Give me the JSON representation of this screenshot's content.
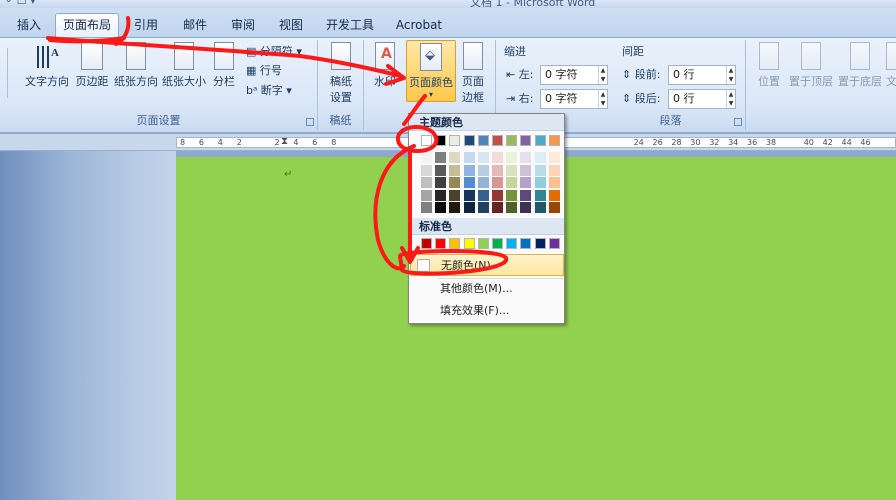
{
  "window": {
    "title": "文档 1 - Microsoft Word",
    "qat": "⚬ ☐ ▾"
  },
  "tabs": [
    "插入",
    "页面布局",
    "引用",
    "邮件",
    "审阅",
    "视图",
    "开发工具",
    "Acrobat"
  ],
  "ribbon": {
    "page_setup": {
      "label": "页面设置",
      "text_direction": "文字方向",
      "margins": "页边距",
      "orientation": "纸张方向",
      "size": "纸张大小",
      "columns": "分栏",
      "breaks": "分隔符",
      "line_numbers": "行号",
      "hyphenation": "断字"
    },
    "draft": {
      "label": "稿纸",
      "button_line1": "稿纸",
      "button_line2": "设置"
    },
    "background": {
      "watermark": "水印",
      "page_color": "页面颜色",
      "page_borders_line1": "页面",
      "page_borders_line2": "边框"
    },
    "paragraph": {
      "label": "段落",
      "indent_title": "缩进",
      "spacing_title": "间距",
      "indent_left_label": "左:",
      "indent_left_value": "0 字符",
      "indent_right_label": "右:",
      "indent_right_value": "0 字符",
      "spacing_before_label": "段前:",
      "spacing_before_value": "0 行",
      "spacing_after_label": "段后:",
      "spacing_after_value": "0 行"
    },
    "arrange": {
      "position": "位置",
      "bring_front": "置于顶层",
      "send_back": "置于底层",
      "text_wrap": "文"
    }
  },
  "ruler": {
    "numbers": [
      "8",
      "6",
      "4",
      "2",
      "",
      "2",
      "4",
      "6",
      "8",
      "",
      "",
      "",
      "",
      "",
      "",
      "",
      "",
      "",
      "",
      "",
      "",
      "",
      "",
      "",
      "24",
      "26",
      "28",
      "30",
      "32",
      "34",
      "36",
      "38",
      "",
      "40",
      "42",
      "44",
      "46"
    ]
  },
  "color_menu": {
    "theme_title": "主题颜色",
    "standard_title": "标准色",
    "theme_colors": [
      "#ffffff",
      "#000000",
      "#eeece1",
      "#1f497d",
      "#4f81bd",
      "#c0504d",
      "#9bbb59",
      "#8064a2",
      "#4bacc6",
      "#f79646"
    ],
    "shade_rows": [
      [
        "#f2f2f2",
        "#7f7f7f",
        "#ddd9c3",
        "#c6d9f0",
        "#dbe5f1",
        "#f2dcdb",
        "#ebf1dd",
        "#e5e0ec",
        "#dbeef3",
        "#fdeada"
      ],
      [
        "#d8d8d8",
        "#595959",
        "#c4bd97",
        "#8db3e2",
        "#b8cce4",
        "#e5b9b7",
        "#d7e3bc",
        "#ccc1d9",
        "#b7dde8",
        "#fbd5b5"
      ],
      [
        "#bfbfbf",
        "#3f3f3f",
        "#938953",
        "#548dd4",
        "#95b3d7",
        "#d99694",
        "#c3d69b",
        "#b2a2c7",
        "#92cddc",
        "#fac08f"
      ],
      [
        "#a5a5a5",
        "#262626",
        "#494429",
        "#17365d",
        "#366092",
        "#953734",
        "#76923c",
        "#5f497a",
        "#31859b",
        "#e36c09"
      ],
      [
        "#7f7f7f",
        "#0c0c0c",
        "#1d1b10",
        "#0f243e",
        "#244061",
        "#632423",
        "#4f6128",
        "#3f3151",
        "#205867",
        "#974806"
      ]
    ],
    "standard_colors": [
      "#c00000",
      "#ff0000",
      "#ffc000",
      "#ffff00",
      "#92d050",
      "#00b050",
      "#00b0f0",
      "#0070c0",
      "#002060",
      "#7030a0"
    ],
    "no_color": "无颜色(N)",
    "more_colors": "其他颜色(M)...",
    "fill_effects": "填充效果(F)..."
  },
  "document": {
    "background_color": "#92d050",
    "paragraph_mark": "↵"
  }
}
